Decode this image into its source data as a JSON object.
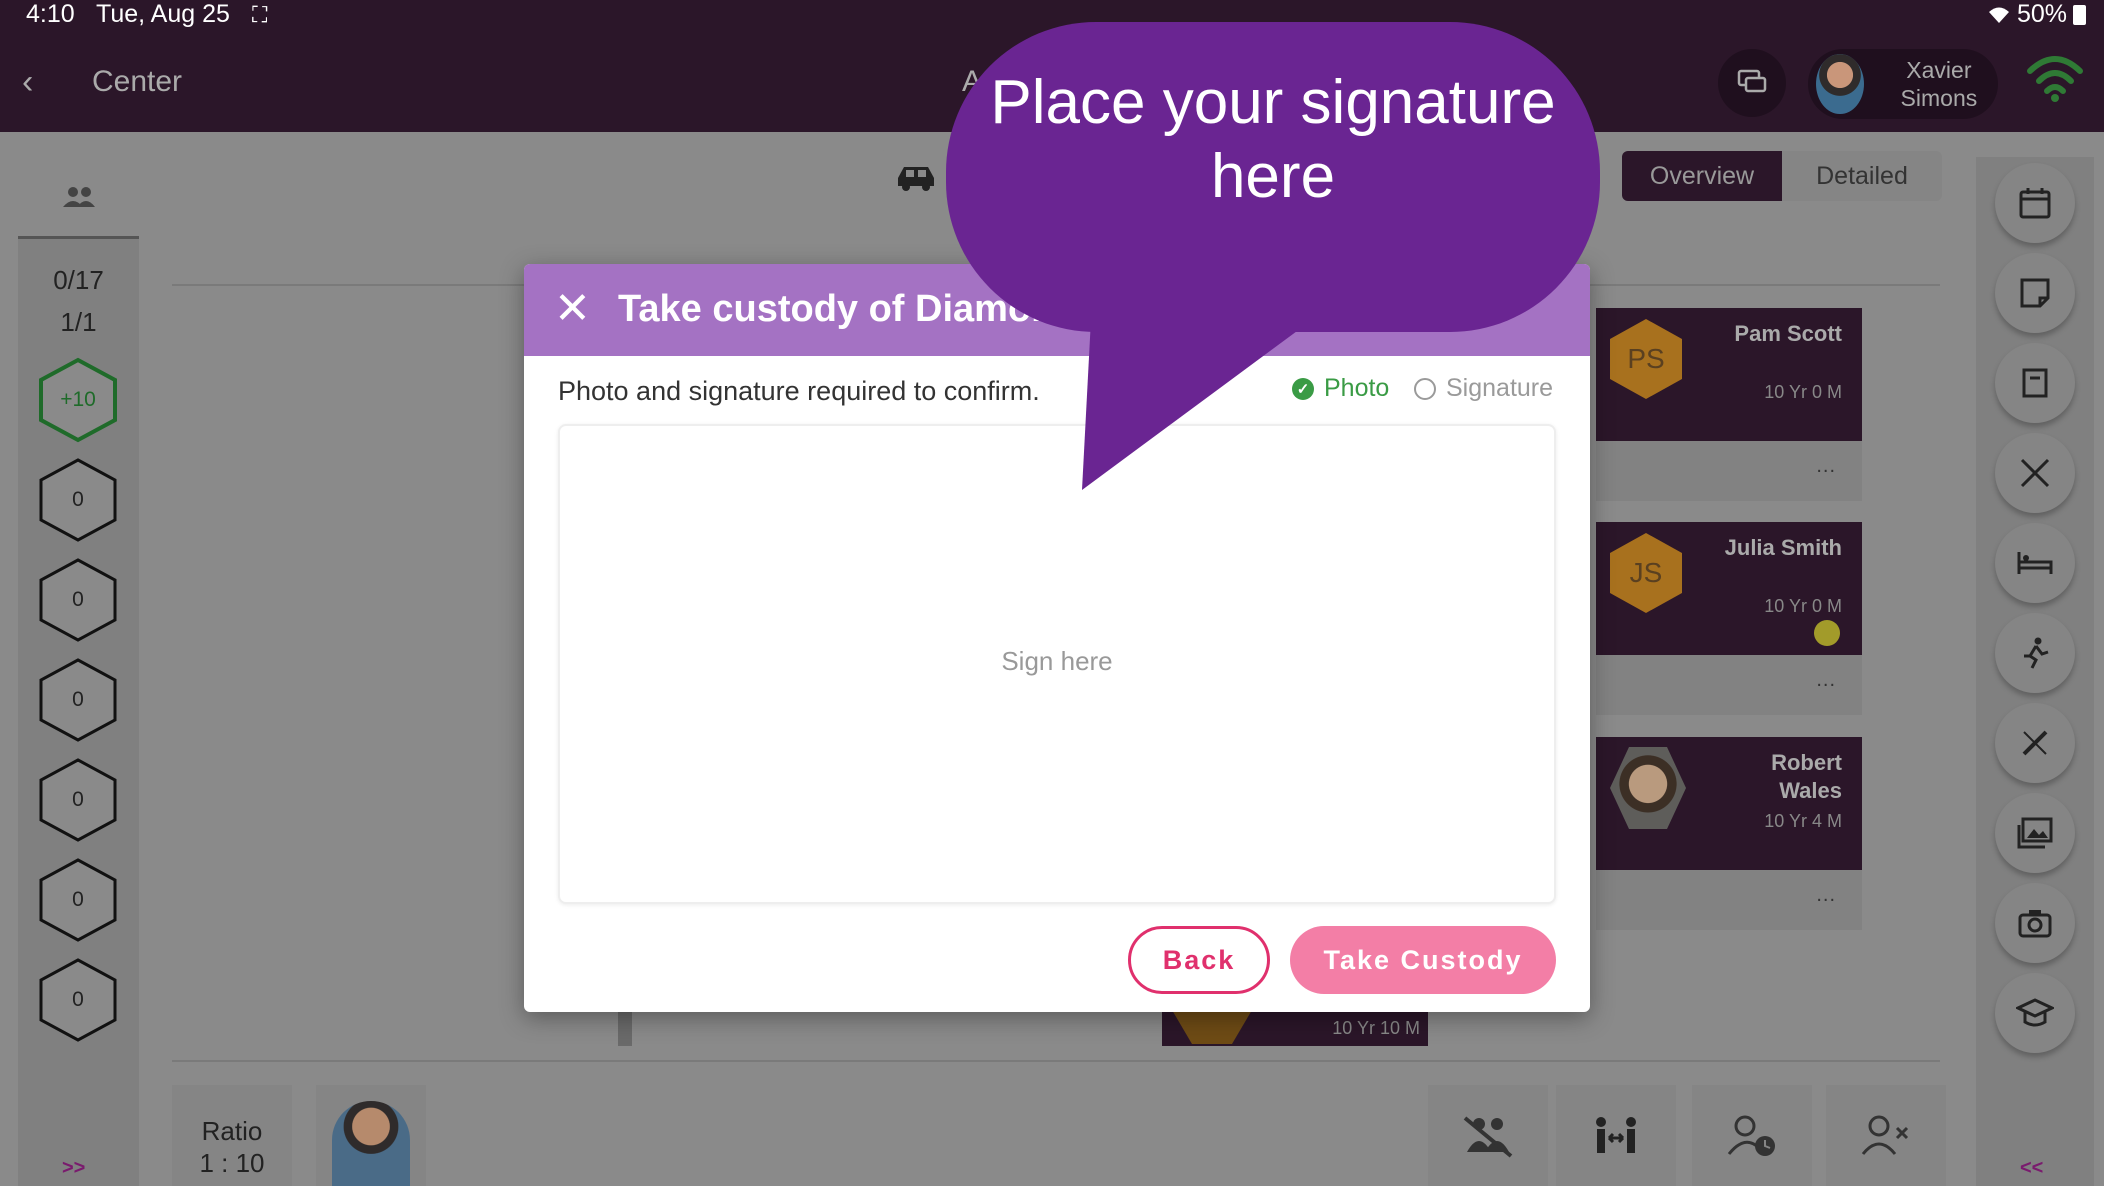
{
  "status_bar": {
    "time": "4:10",
    "date": "Tue, Aug 25",
    "battery": "50%"
  },
  "header": {
    "back_label": "<",
    "center_title": "Center",
    "page_title_partial": "A",
    "user_name": "Xavier Simons"
  },
  "left_sidebar": {
    "counts": [
      "0/17",
      "1/1"
    ],
    "badges": [
      "+10",
      "0",
      "0",
      "0",
      "0",
      "0",
      "0"
    ],
    "expand_label": ">>"
  },
  "main": {
    "view_tabs": [
      "Overview",
      "Detailed"
    ],
    "children": [
      {
        "initials": "PS",
        "name": "Pam Scott",
        "age": "10 Yr 0 M"
      },
      {
        "initials": "JS",
        "name": "Julia Smith",
        "age": "10 Yr 0 M"
      },
      {
        "initials": "",
        "name": "Robert Wales",
        "age": "10 Yr 4 M"
      }
    ],
    "behind_card_age": "10 Yr 10 M",
    "card_menu": "..."
  },
  "bottom_bar": {
    "ratio_label": "Ratio",
    "ratio_value": "1 : 10"
  },
  "right_sidebar": {
    "collapse_label": "<<"
  },
  "modal": {
    "title": "Take custody of Diamon",
    "close_label": "✕",
    "instruction": "Photo and signature required to confirm.",
    "requirements": [
      {
        "label": "Photo",
        "done": true
      },
      {
        "label": "Signature",
        "done": false
      }
    ],
    "signature_placeholder": "Sign here",
    "back_label": "Back",
    "confirm_label": "Take Custody"
  },
  "tooltip": {
    "text": "Place your signature here"
  },
  "colors": {
    "header_bg": "#2b1629",
    "modal_header": "#a472c3",
    "accent_pink": "#e0306d",
    "confirm_pink": "#f37ea6",
    "tooltip_purple": "#6a2592",
    "success_green": "#3a9b45"
  }
}
